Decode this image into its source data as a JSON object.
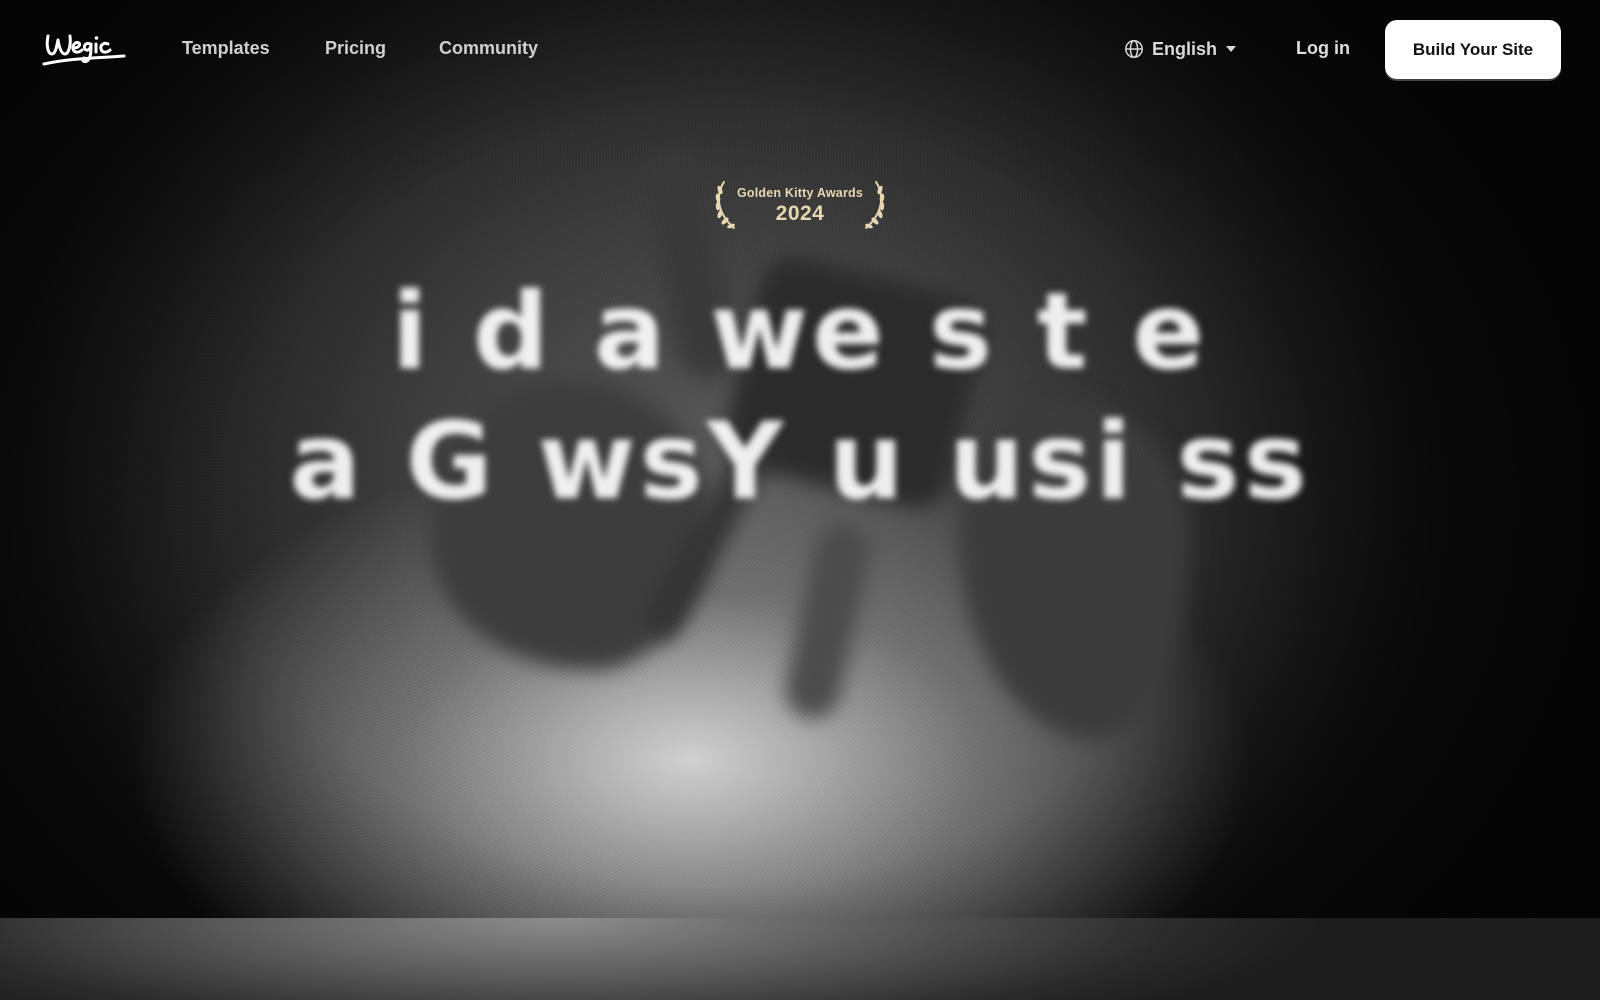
{
  "navbar": {
    "logo_text": "wegic",
    "links": [
      "Templates",
      "Pricing",
      "Community"
    ],
    "language": {
      "label": "English",
      "icon": "globe-icon",
      "caret_icon": "caret-down-icon"
    },
    "login_label": "Log in",
    "cta_label": "Build Your Site"
  },
  "hero": {
    "award": {
      "title": "Golden Kitty Awards",
      "year": "2024",
      "icon": "laurel-icon",
      "color": "#e6d7b2"
    },
    "headline_line_1": "i d a we  s t e",
    "headline_line_2": "a G  wsY u   usi    ss"
  },
  "colors": {
    "background": "#0b0b0b",
    "cta_background": "#ffffff",
    "cta_text": "#111111",
    "nav_text": "#cfcfcf",
    "award_gold": "#e6d7b2"
  }
}
